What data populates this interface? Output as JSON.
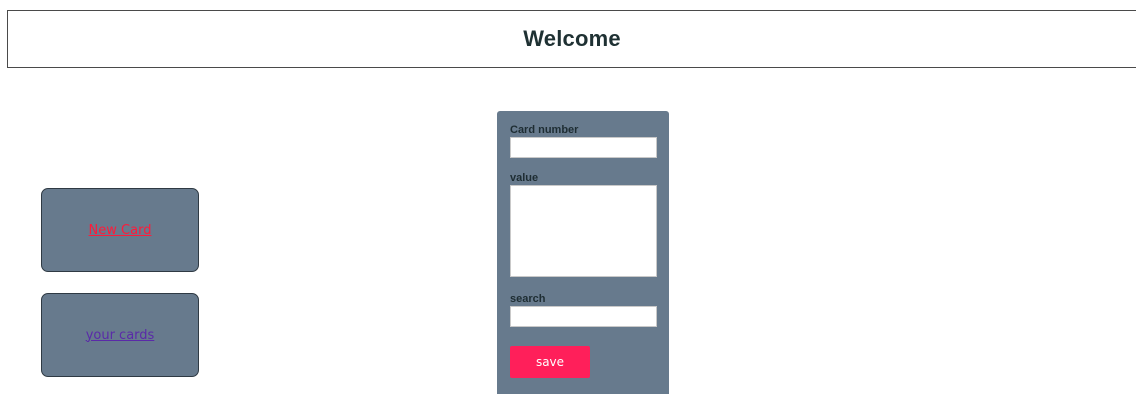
{
  "header": {
    "title": "Welcome"
  },
  "nav": {
    "new_card": "New Card",
    "your_cards": "your cards"
  },
  "form": {
    "card_number_label": "Card number",
    "card_number_value": "",
    "value_label": "value",
    "value_value": "",
    "search_label": "search",
    "search_value": "",
    "save_label": "save"
  },
  "colors": {
    "panel_bg": "#677a8d",
    "save_button": "#ff1f5a",
    "new_card_link": "#ff1a3a",
    "your_cards_link": "#5a2aa8",
    "title_text": "#1f3133"
  }
}
